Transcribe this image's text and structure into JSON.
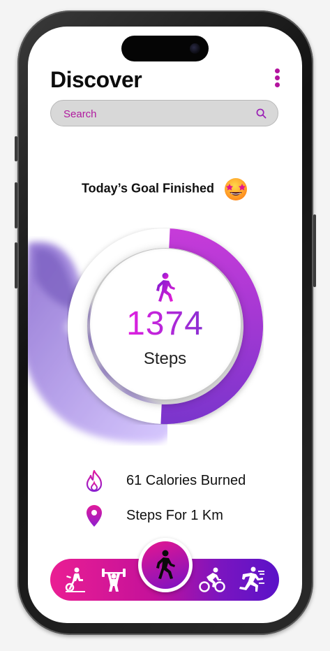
{
  "header": {
    "title": "Discover",
    "menu_icon": "kebab-menu-icon"
  },
  "search": {
    "placeholder": "Search",
    "icon": "search-icon"
  },
  "goal": {
    "text": "Today’s Goal Finished",
    "emoji": "star-struck-emoji-icon"
  },
  "progress": {
    "steps": "1374",
    "label": "Steps",
    "fraction": 0.5,
    "ring_color_start": "#c73bd9",
    "ring_color_end": "#7a35cc"
  },
  "stats": [
    {
      "icon": "flame-icon",
      "label": "61 Calories Burned"
    },
    {
      "icon": "location-pin-icon",
      "label": "Steps For 1 Km"
    }
  ],
  "nav": {
    "items": [
      "exercise-bike-icon",
      "weightlifting-icon",
      "walking-icon",
      "cycling-icon",
      "running-icon"
    ],
    "active": "walking-icon",
    "gradient": [
      "#ea1e93",
      "#5a12c8"
    ]
  },
  "colors": {
    "accent": "#b3139e",
    "steps_gradient": [
      "#e11fe0",
      "#8a2ed2"
    ]
  }
}
